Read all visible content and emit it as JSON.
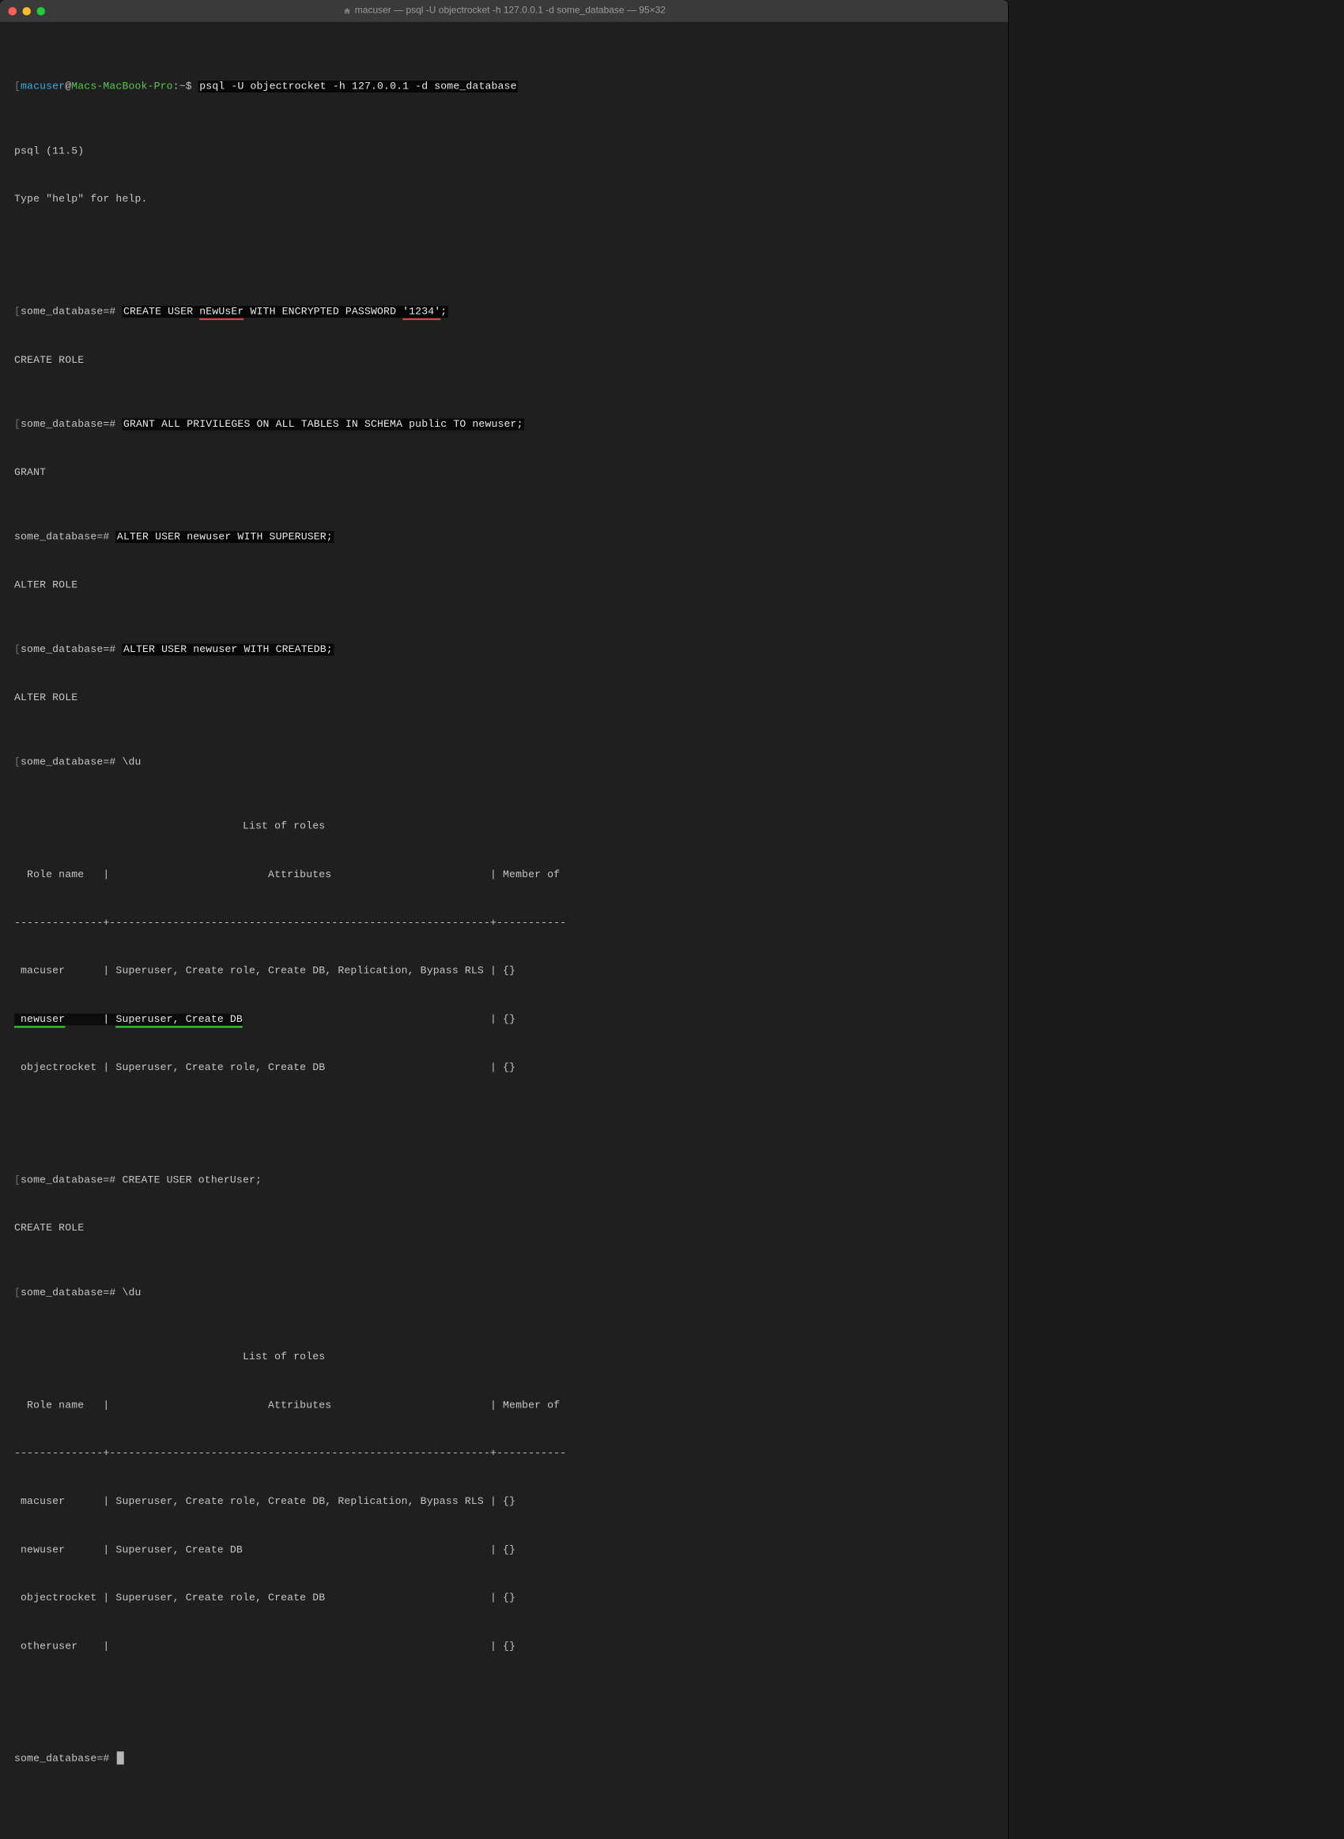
{
  "window": {
    "title": "macuser — psql -U objectrocket -h 127.0.0.1 -d some_database — 95×32"
  },
  "prompt": {
    "user": "macuser",
    "at": "@",
    "host": "Macs-MacBook-Pro",
    "sep": ":",
    "path": "~",
    "sigil": "$"
  },
  "cmd": {
    "psql": "psql -U objectrocket -h 127.0.0.1 -d some_database"
  },
  "out": {
    "psql_ver": "psql (11.5)",
    "help": "Type \"help\" for help.",
    "create_role": "CREATE ROLE",
    "grant": "GRANT",
    "alter_role": "ALTER ROLE"
  },
  "db_prompt": "some_database=#",
  "sql": {
    "create_user_pre": "CREATE USER ",
    "create_user_name": "nEwUsEr",
    "create_user_mid": " WITH ENCRYPTED PASSWORD ",
    "create_user_pw": "'1234'",
    "create_user_end": ";",
    "grant_all": "GRANT ALL PRIVILEGES ON ALL TABLES IN SCHEMA public TO newuser;",
    "alter_super": "ALTER USER newuser WITH SUPERUSER;",
    "alter_createdb": "ALTER USER newuser WITH CREATEDB;",
    "du": "\\du",
    "create_other": "CREATE USER otherUser;"
  },
  "table1": {
    "header": "                                    List of roles",
    "cols": "  Role name   |                         Attributes                         | Member of ",
    "sep": "--------------+------------------------------------------------------------+-----------",
    "r1": " macuser      | Superuser, Create role, Create DB, Replication, Bypass RLS | {}",
    "r2a": " newuser",
    "r2b": "      | ",
    "r2c": "Superuser, Create DB",
    "r2d": "                                       | {}",
    "r3": " objectrocket | Superuser, Create role, Create DB                          | {}"
  },
  "table2": {
    "header": "                                    List of roles",
    "cols": "  Role name   |                         Attributes                         | Member of ",
    "sep": "--------------+------------------------------------------------------------+-----------",
    "r1": " macuser      | Superuser, Create role, Create DB, Replication, Bypass RLS | {}",
    "r2": " newuser      | Superuser, Create DB                                       | {}",
    "r3": " objectrocket | Superuser, Create role, Create DB                          | {}",
    "r4": " otheruser    |                                                            | {}"
  }
}
